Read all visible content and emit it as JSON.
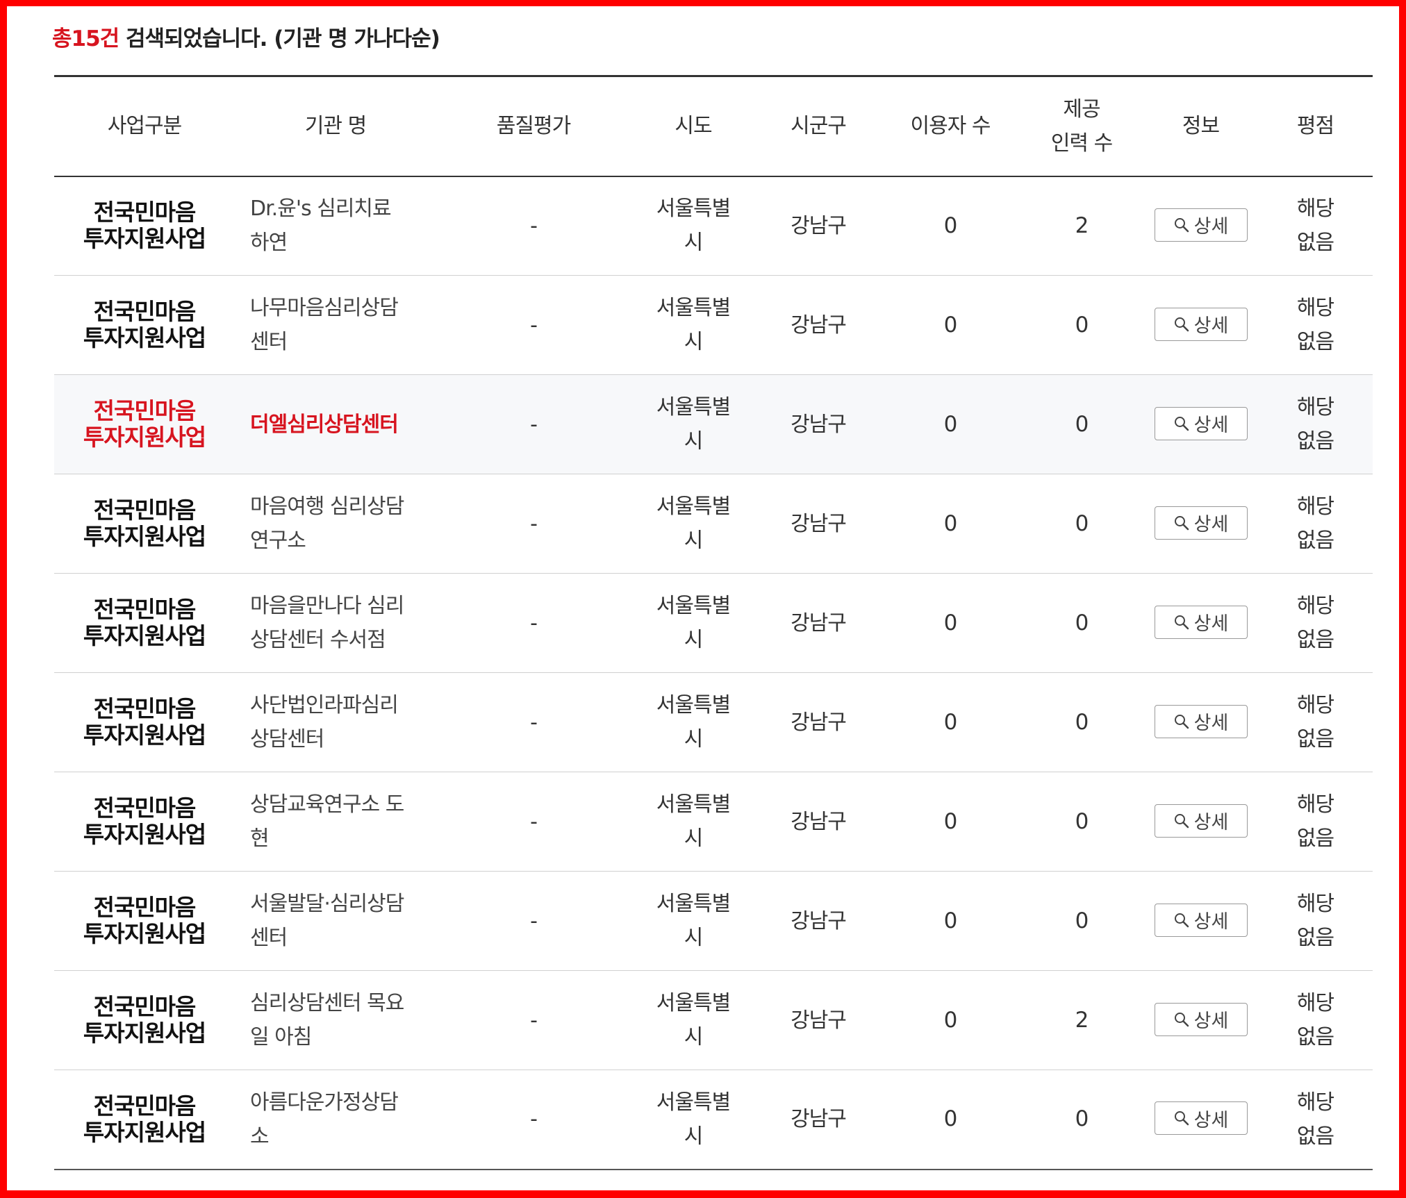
{
  "summary": {
    "prefix": "총",
    "count": "15건",
    "suffix": " 검색되었습니다. (기관 명 가나다순)"
  },
  "headers": {
    "business": "사업구분",
    "name": "기관 명",
    "quality": "품질평가",
    "sido": "시도",
    "sigungu": "시군구",
    "users": "이용자 수",
    "staff_line1": "제공",
    "staff_line2": "인력 수",
    "info": "정보",
    "rating": "평점"
  },
  "detail_label": "상세",
  "rows": [
    {
      "biz1": "전국민마음",
      "biz2": "투자지원사업",
      "name1": "Dr.윤's 심리치료",
      "name2": "하연",
      "quality": "-",
      "sido1": "서울특별",
      "sido2": "시",
      "sigungu": "강남구",
      "users": "0",
      "staff": "2",
      "rating1": "해당",
      "rating2": "없음"
    },
    {
      "biz1": "전국민마음",
      "biz2": "투자지원사업",
      "name1": "나무마음심리상담",
      "name2": "센터",
      "quality": "-",
      "sido1": "서울특별",
      "sido2": "시",
      "sigungu": "강남구",
      "users": "0",
      "staff": "0",
      "rating1": "해당",
      "rating2": "없음"
    },
    {
      "biz1": "전국민마음",
      "biz2": "투자지원사업",
      "name1": "더엘심리상담센터",
      "name2": "",
      "quality": "-",
      "sido1": "서울특별",
      "sido2": "시",
      "sigungu": "강남구",
      "users": "0",
      "staff": "0",
      "rating1": "해당",
      "rating2": "없음"
    },
    {
      "biz1": "전국민마음",
      "biz2": "투자지원사업",
      "name1": "마음여행 심리상담",
      "name2": "연구소",
      "quality": "-",
      "sido1": "서울특별",
      "sido2": "시",
      "sigungu": "강남구",
      "users": "0",
      "staff": "0",
      "rating1": "해당",
      "rating2": "없음"
    },
    {
      "biz1": "전국민마음",
      "biz2": "투자지원사업",
      "name1": "마음을만나다 심리",
      "name2": "상담센터 수서점",
      "quality": "-",
      "sido1": "서울특별",
      "sido2": "시",
      "sigungu": "강남구",
      "users": "0",
      "staff": "0",
      "rating1": "해당",
      "rating2": "없음"
    },
    {
      "biz1": "전국민마음",
      "biz2": "투자지원사업",
      "name1": "사단법인라파심리",
      "name2": "상담센터",
      "quality": "-",
      "sido1": "서울특별",
      "sido2": "시",
      "sigungu": "강남구",
      "users": "0",
      "staff": "0",
      "rating1": "해당",
      "rating2": "없음"
    },
    {
      "biz1": "전국민마음",
      "biz2": "투자지원사업",
      "name1": "상담교육연구소 도",
      "name2": "현",
      "quality": "-",
      "sido1": "서울특별",
      "sido2": "시",
      "sigungu": "강남구",
      "users": "0",
      "staff": "0",
      "rating1": "해당",
      "rating2": "없음"
    },
    {
      "biz1": "전국민마음",
      "biz2": "투자지원사업",
      "name1": "서울발달·심리상담",
      "name2": "센터",
      "quality": "-",
      "sido1": "서울특별",
      "sido2": "시",
      "sigungu": "강남구",
      "users": "0",
      "staff": "0",
      "rating1": "해당",
      "rating2": "없음"
    },
    {
      "biz1": "전국민마음",
      "biz2": "투자지원사업",
      "name1": "심리상담센터 목요",
      "name2": "일 아침",
      "quality": "-",
      "sido1": "서울특별",
      "sido2": "시",
      "sigungu": "강남구",
      "users": "0",
      "staff": "2",
      "rating1": "해당",
      "rating2": "없음"
    },
    {
      "biz1": "전국민마음",
      "biz2": "투자지원사업",
      "name1": "아름다운가정상담",
      "name2": "소",
      "quality": "-",
      "sido1": "서울특별",
      "sido2": "시",
      "sigungu": "강남구",
      "users": "0",
      "staff": "0",
      "rating1": "해당",
      "rating2": "없음"
    }
  ],
  "colors": {
    "accent_red": "#d7141f",
    "frame_red": "#ff0000",
    "highlight_row_bg": "#f7f8fa"
  }
}
